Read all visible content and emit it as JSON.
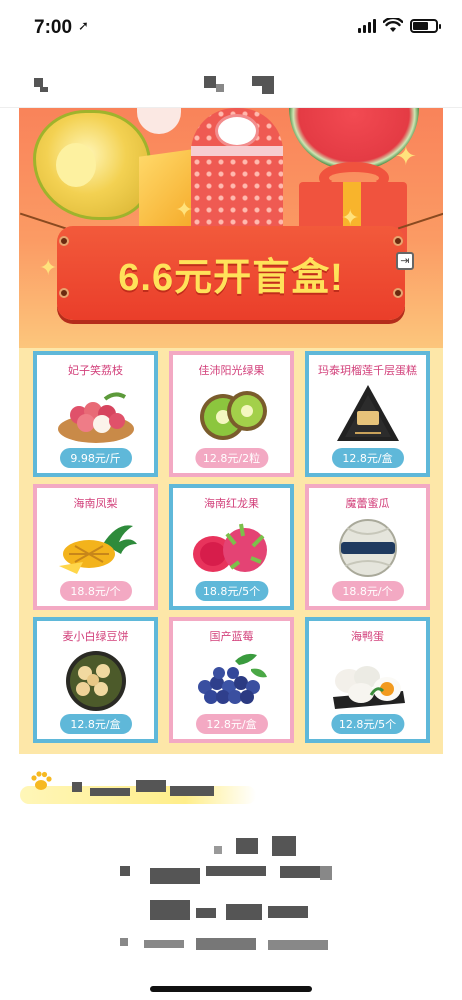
{
  "status_bar": {
    "time": "7:00",
    "location_icon": "location-arrow-icon",
    "signal_icon": "cellular-signal-icon",
    "wifi_icon": "wifi-icon",
    "battery_icon": "battery-icon",
    "battery_level": 0.7
  },
  "poster": {
    "title": "6.6元开盲盒!",
    "colors": {
      "background": "#fde7a8",
      "banner": "#ea3e2a",
      "title_text": "#ffe25a",
      "blue_frame": "#5fb8d9",
      "pink_frame": "#f3a9c3",
      "name_text": "#d23f7a"
    }
  },
  "products": [
    {
      "name": "妃子笑荔枝",
      "price": "9.98元/斤",
      "frame": "blue",
      "icon": "lychee-icon"
    },
    {
      "name": "佳沛阳光绿果",
      "price": "12.8元/2粒",
      "frame": "pink",
      "icon": "kiwi-icon"
    },
    {
      "name": "玛泰玥榴莲千层蛋糕",
      "price": "12.8元/盒",
      "frame": "blue",
      "icon": "durian-cake-icon"
    },
    {
      "name": "海南凤梨",
      "price": "18.8元/个",
      "frame": "pink",
      "icon": "pineapple-icon"
    },
    {
      "name": "海南红龙果",
      "price": "18.8元/5个",
      "frame": "blue",
      "icon": "dragon-fruit-icon"
    },
    {
      "name": "魔蕾蜜瓜",
      "price": "18.8元/个",
      "frame": "pink",
      "icon": "melon-icon"
    },
    {
      "name": "麦小白绿豆饼",
      "price": "12.8元/盒",
      "frame": "blue",
      "icon": "mung-bean-cake-icon"
    },
    {
      "name": "国产蓝莓",
      "price": "12.8元/盒",
      "frame": "pink",
      "icon": "blueberry-icon"
    },
    {
      "name": "海鸭蛋",
      "price": "12.8元/5个",
      "frame": "blue",
      "icon": "salted-egg-icon"
    }
  ],
  "share_icon": "share-exit-icon",
  "section_icon": "paw-icon"
}
